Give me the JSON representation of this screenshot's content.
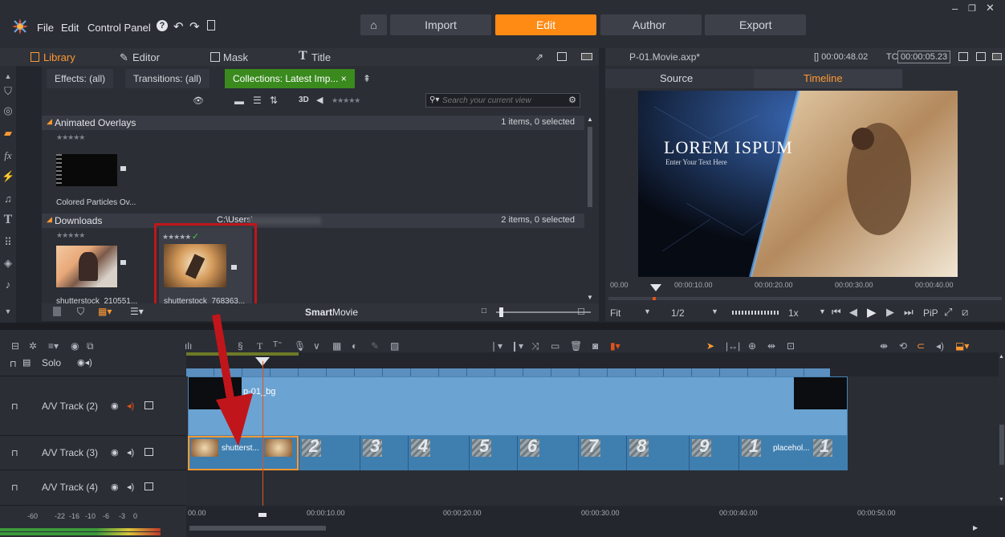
{
  "menu": {
    "file": "File",
    "edit": "Edit",
    "control_panel": "Control Panel"
  },
  "modes": {
    "import": "Import",
    "edit": "Edit",
    "author": "Author",
    "export": "Export"
  },
  "library_tabs": {
    "library": "Library",
    "editor": "Editor",
    "mask": "Mask",
    "title": "Title"
  },
  "lib_subtabs": {
    "effects": "Effects: (all)",
    "transitions": "Transitions: (all)",
    "collections": "Collections: Latest Imp... ×"
  },
  "search": {
    "placeholder": "Search your current view"
  },
  "toolbar": {
    "view3d": "3D",
    "smartmovie_a": "Smart",
    "smartmovie_b": "Movie"
  },
  "categories": {
    "overlays": {
      "title": "Animated Overlays",
      "count": "1 items, 0 selected",
      "item": "Colored Particles Ov..."
    },
    "downloads": {
      "title": "Downloads",
      "path": "C:\\Users\\",
      "count": "2 items, 0 selected",
      "item1": "shutterstock_210551...",
      "item2": "shutterstock_768363..."
    }
  },
  "stars": {
    "empty": "★★★★★",
    "selected": "★★★★★ ✓"
  },
  "preview": {
    "project": "P-01.Movie.axp*",
    "duration": "[] 00:00:48.02",
    "tc_label": "TC",
    "tc_value": "00:00:05.23",
    "source_tab": "Source",
    "timeline_tab": "Timeline",
    "title_text": "LOREM ISPUM",
    "subtitle_text": "Enter Your Text Here",
    "scale": [
      "00.00",
      "00:00:10.00",
      "00:00:20.00",
      "00:00:30.00",
      "00:00:40.00"
    ],
    "fit": "Fit",
    "ratio": "1/2",
    "speed": "1x",
    "pip": "PiP"
  },
  "tracks": {
    "solo": "Solo",
    "track2": "A/V Track (2)",
    "track3": "A/V Track (3)",
    "track4": "A/V Track (4)"
  },
  "clips": {
    "bg": "p-01_bg",
    "shutter": "shutterst...",
    "numbers": [
      "2",
      "3",
      "4",
      "5",
      "6",
      "7",
      "8",
      "9",
      "1"
    ],
    "placeholder": "placehol...",
    "last_num": "1"
  },
  "timeline_scale": [
    "00.00",
    "00:00:10.00",
    "00:00:20.00",
    "00:00:30.00",
    "00:00:40.00",
    "00:00:50.00"
  ],
  "audio_meter": [
    "-60",
    "-22",
    "-16",
    "-10",
    "-6",
    "-3",
    "0"
  ],
  "colors": {
    "accent": "#ff8a14",
    "collections_tab": "#3a8a1e",
    "clip": "#3f7fb0",
    "highlight_box": "#c0161b",
    "playhead": "#e2521b"
  }
}
